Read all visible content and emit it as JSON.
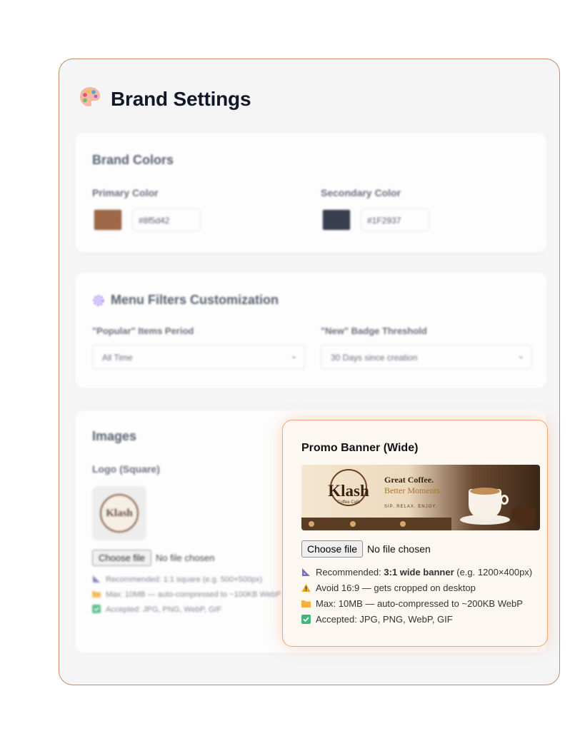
{
  "page": {
    "title": "Brand Settings"
  },
  "brand_colors": {
    "title": "Brand Colors",
    "primary": {
      "label": "Primary Color",
      "value": "#8f5d42",
      "swatch": "#8b4a22"
    },
    "secondary": {
      "label": "Secondary Color",
      "value": "#1F2937",
      "swatch": "#0f172a"
    }
  },
  "menu_filters": {
    "title": "Menu Filters Customization",
    "popular": {
      "label": "\"Popular\" Items Period",
      "selected": "All Time"
    },
    "new_badge": {
      "label": "\"New\" Badge Threshold",
      "selected": "30 Days since creation"
    }
  },
  "images": {
    "title": "Images",
    "logo": {
      "label": "Logo (Square)",
      "logo_text": "Klash",
      "choose_label": "Choose file",
      "status": "No file chosen",
      "hints": [
        "Recommended: 1:1 square (e.g. 500×500px)",
        "Max: 10MB — auto-compressed to ~100KB WebP",
        "Accepted: JPG, PNG, WebP, GIF"
      ]
    },
    "promo": {
      "label": "Promo Banner (Wide)",
      "banner": {
        "brand": "Klash",
        "brand_sub": "Coffee Café",
        "headline_1": "Great Coffee.",
        "headline_2": "Better Moments.",
        "tagline": "SIP. RELAX. ENJOY."
      },
      "choose_label": "Choose file",
      "status": "No file chosen",
      "hint_recommended_prefix": "Recommended: ",
      "hint_recommended_bold": "3:1 wide banner",
      "hint_recommended_suffix": " (e.g. 1200×400px)",
      "hint_avoid": "Avoid 16:9 — gets cropped on desktop",
      "hint_max": "Max: 10MB — auto-compressed to ~200KB WebP",
      "hint_accepted": "Accepted: JPG, PNG, WebP, GIF"
    }
  }
}
